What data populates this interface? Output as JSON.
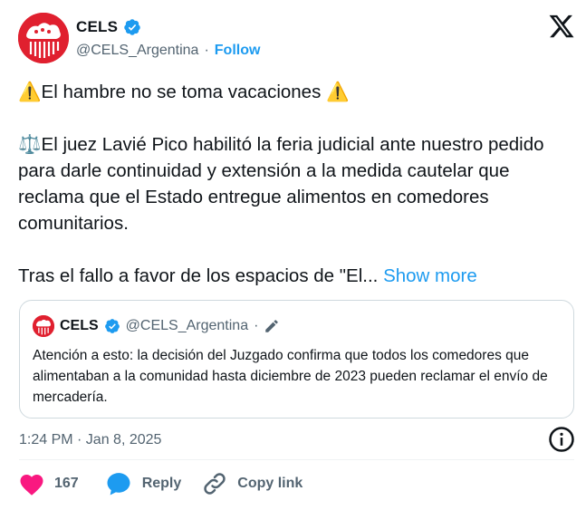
{
  "author": {
    "name": "CELS",
    "handle": "@CELS_Argentina",
    "separator": "·",
    "follow_label": "Follow"
  },
  "tweet": {
    "line1": "⚠️El hambre no se toma vacaciones ⚠️",
    "paragraph2": "⚖️El juez Lavié Pico habilitó la feria judicial ante nuestro pedido para darle continuidad y extensión a la medida cautelar que reclama que el Estado entregue alimentos en comedores comunitarios.",
    "paragraph3": "Tras el fallo a favor de los espacios de \"El...",
    "show_more": "Show more"
  },
  "quote": {
    "name": "CELS",
    "handle": "@CELS_Argentina",
    "separator": "·",
    "text": "Atención a esto: la decisión del Juzgado confirma que todos los comedores que alimentaban a la comunidad hasta diciembre de 2023 pueden reclamar el envío de mercadería."
  },
  "timestamp": "1:24 PM · Jan 8, 2025",
  "actions": {
    "likes": "167",
    "reply": "Reply",
    "copy_link": "Copy link"
  },
  "colors": {
    "accent": "#1d9bf0",
    "like": "#f91880",
    "brand_red": "#e0202f"
  }
}
